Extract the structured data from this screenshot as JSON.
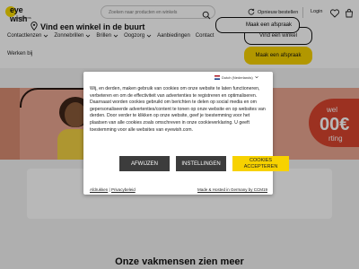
{
  "header": {
    "logo_text": "eye wish",
    "logo_sub": "opticiens",
    "search_placeholder": "Zoeken naar producten en winkels",
    "order_label": "Opnieuw bestellen",
    "login_label": "Login",
    "icons": [
      "search-icon",
      "refresh-icon",
      "heart-icon",
      "cart-icon"
    ]
  },
  "nav": {
    "items": [
      {
        "label": "Contactlenzen",
        "has_dropdown": true
      },
      {
        "label": "Zonnebrillen",
        "has_dropdown": true
      },
      {
        "label": "Brillen",
        "has_dropdown": true
      },
      {
        "label": "Oogzorg",
        "has_dropdown": true
      },
      {
        "label": "Aanbiedingen",
        "has_dropdown": false
      },
      {
        "label": "Contact",
        "has_dropdown": false
      }
    ],
    "row2_item": "Werken bij",
    "find_store_button": "Vind een winkel",
    "appointment_button": "Maak een afspraak"
  },
  "banner": {
    "promo_word_1": "wel",
    "promo_amount": "00€",
    "promo_word_2": "rting"
  },
  "store_finder": {
    "text": "Vind een winkel in de buurt",
    "button": "Maak een afspraak"
  },
  "section_title": "Onze vakmensen zien meer",
  "cookie_modal": {
    "language": "Dutch (Nederlands)",
    "body": "Wij, en derden, maken gebruik van cookies om onze website te laten functioneren, verbeteren en om de effectiviteit van advertenties te registreren en optimaliseren. Daarnaast worden cookies gebruikt om berichten te delen op social media en om gepersonaliseerde advertenties/content te tonen op onze website en op websites van derden. Door verder te klikken op onze website, geef je toestemming voor het plaatsen van alle cookies zoals omschreven in onze cookieverklaring. U geeft toestemming voor alle websites van eyewish.com.",
    "reject_button": "AFWIJZEN",
    "settings_button": "INSTELLINGEN",
    "accept_button": "COOKIES ACCEPTEREN",
    "footer_link_1": "Afdrukken",
    "footer_separator": " | ",
    "footer_link_2": "Privacybeleid",
    "footer_right": "Made & Hosted in Germany by CCM19"
  },
  "colors": {
    "brand_yellow": "#f7d200",
    "dark_button": "#3c3c3c",
    "banner_bg": "#e9a590",
    "promo_red": "#d8452f"
  }
}
